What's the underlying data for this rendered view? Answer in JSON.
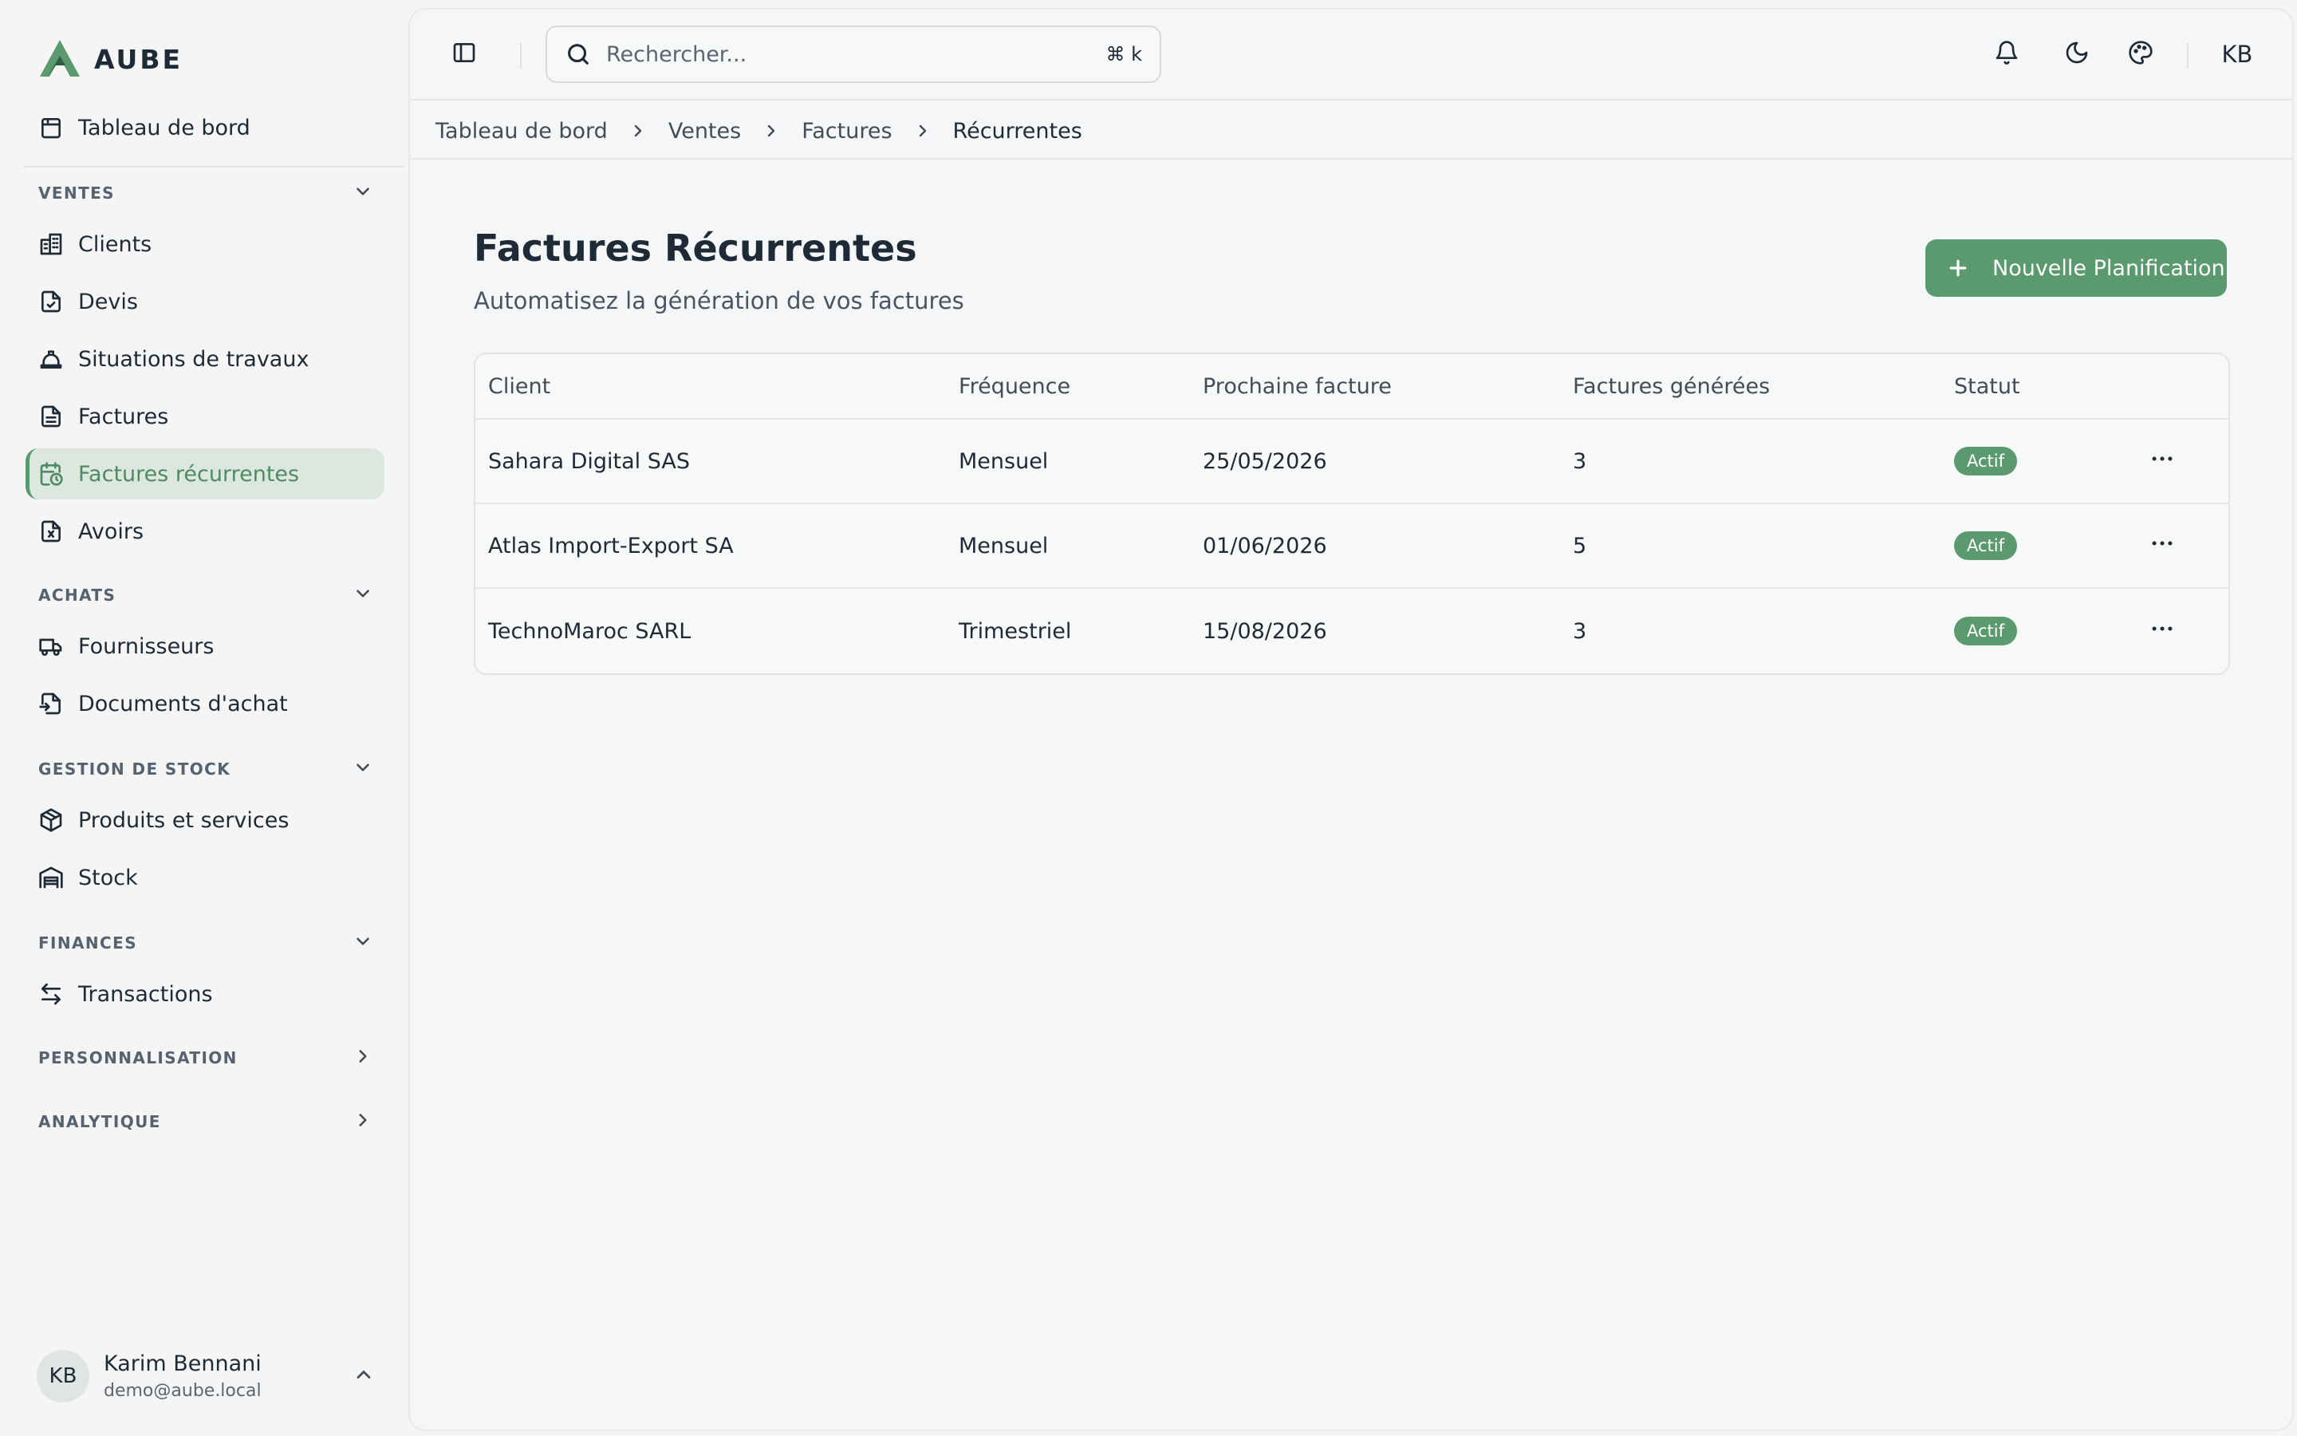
{
  "brand": {
    "name": "AUBE",
    "accent": "#5b9a6e"
  },
  "sidebar": {
    "dashboard": {
      "label": "Tableau de bord",
      "icon": "calendar-square-icon"
    },
    "sections": [
      {
        "label": "VENTES",
        "expanded": true,
        "items": [
          {
            "label": "Clients",
            "icon": "building-icon"
          },
          {
            "label": "Devis",
            "icon": "file-check-icon"
          },
          {
            "label": "Situations de travaux",
            "icon": "hard-hat-icon"
          },
          {
            "label": "Factures",
            "icon": "file-text-icon"
          },
          {
            "label": "Factures récurrentes",
            "icon": "calendar-clock-icon",
            "active": true
          },
          {
            "label": "Avoirs",
            "icon": "file-x-icon"
          }
        ]
      },
      {
        "label": "ACHATS",
        "expanded": true,
        "items": [
          {
            "label": "Fournisseurs",
            "icon": "truck-icon"
          },
          {
            "label": "Documents d'achat",
            "icon": "file-input-icon"
          }
        ]
      },
      {
        "label": "GESTION DE STOCK",
        "expanded": true,
        "items": [
          {
            "label": "Produits et services",
            "icon": "package-icon"
          },
          {
            "label": "Stock",
            "icon": "warehouse-icon"
          }
        ]
      },
      {
        "label": "FINANCES",
        "expanded": true,
        "items": [
          {
            "label": "Transactions",
            "icon": "arrows-left-right-icon"
          }
        ]
      },
      {
        "label": "PERSONNALISATION",
        "expanded": false,
        "items": []
      },
      {
        "label": "ANALYTIQUE",
        "expanded": false,
        "items": []
      }
    ],
    "user": {
      "initials": "KB",
      "name": "Karim Bennani",
      "email": "demo@aube.local"
    }
  },
  "topbar": {
    "search_placeholder": "Rechercher...",
    "shortcut": "⌘ k",
    "avatar_initials": "KB"
  },
  "breadcrumb": [
    "Tableau de bord",
    "Ventes",
    "Factures",
    "Récurrentes"
  ],
  "page": {
    "title": "Factures Récurrentes",
    "subtitle": "Automatisez la génération de vos factures",
    "primary_button": "Nouvelle Planification"
  },
  "table": {
    "columns": [
      "Client",
      "Fréquence",
      "Prochaine facture",
      "Factures générées",
      "Statut"
    ],
    "rows": [
      {
        "client": "Sahara Digital SAS",
        "frequency": "Mensuel",
        "next": "25/05/2026",
        "generated": "3",
        "status": "Actif"
      },
      {
        "client": "Atlas Import-Export SA",
        "frequency": "Mensuel",
        "next": "01/06/2026",
        "generated": "5",
        "status": "Actif"
      },
      {
        "client": "TechnoMaroc SARL",
        "frequency": "Trimestriel",
        "next": "15/08/2026",
        "generated": "3",
        "status": "Actif"
      }
    ]
  }
}
